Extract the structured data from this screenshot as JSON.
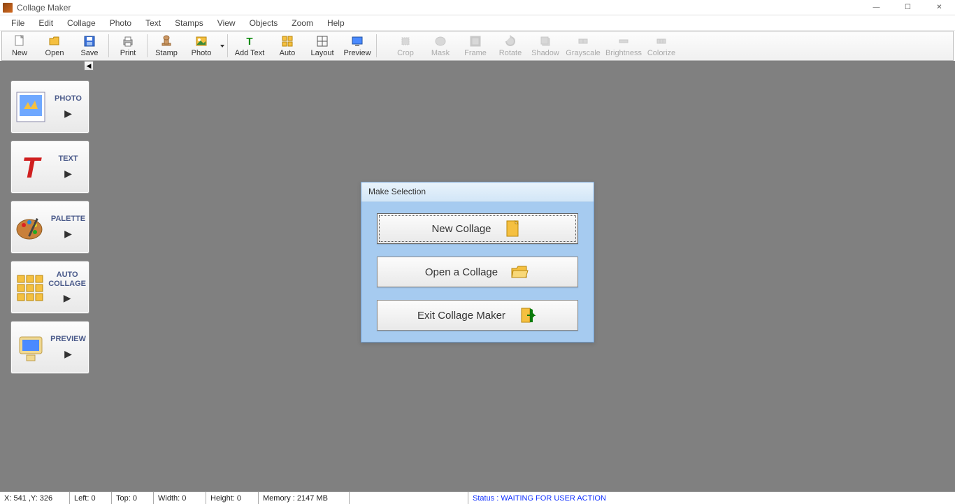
{
  "window": {
    "title": "Collage Maker",
    "controls": {
      "min": "—",
      "max": "☐",
      "close": "✕"
    }
  },
  "menu": [
    "File",
    "Edit",
    "Collage",
    "Photo",
    "Text",
    "Stamps",
    "View",
    "Objects",
    "Zoom",
    "Help"
  ],
  "toolbar": {
    "primary": [
      {
        "id": "new",
        "label": "New"
      },
      {
        "id": "open",
        "label": "Open"
      },
      {
        "id": "save",
        "label": "Save"
      },
      {
        "id": "print",
        "label": "Print"
      },
      {
        "id": "stamp",
        "label": "Stamp"
      },
      {
        "id": "photo",
        "label": "Photo",
        "dropdown": true
      },
      {
        "id": "addtext",
        "label": "Add Text"
      },
      {
        "id": "auto",
        "label": "Auto"
      },
      {
        "id": "layout",
        "label": "Layout"
      },
      {
        "id": "preview",
        "label": "Preview"
      }
    ],
    "secondary": [
      {
        "id": "crop",
        "label": "Crop"
      },
      {
        "id": "mask",
        "label": "Mask"
      },
      {
        "id": "frame",
        "label": "Frame"
      },
      {
        "id": "rotate",
        "label": "Rotate"
      },
      {
        "id": "shadow",
        "label": "Shadow"
      },
      {
        "id": "grayscale",
        "label": "Grayscale"
      },
      {
        "id": "brightness",
        "label": "Brightness"
      },
      {
        "id": "colorize",
        "label": "Colorize"
      }
    ]
  },
  "sidebar": [
    {
      "id": "photo",
      "label": "PHOTO"
    },
    {
      "id": "text",
      "label": "TEXT"
    },
    {
      "id": "palette",
      "label": "PALETTE"
    },
    {
      "id": "autocollage",
      "label": "AUTO COLLAGE"
    },
    {
      "id": "preview",
      "label": "PREVIEW"
    }
  ],
  "dialog": {
    "title": "Make Selection",
    "buttons": [
      {
        "id": "new-collage",
        "label": "New Collage"
      },
      {
        "id": "open-collage",
        "label": "Open a Collage"
      },
      {
        "id": "exit",
        "label": "Exit Collage Maker"
      }
    ]
  },
  "status": {
    "coords": "X: 541 ,Y: 326",
    "left": "Left: 0",
    "top": "Top: 0",
    "width": "Width: 0",
    "height": "Height: 0",
    "memory": "Memory : 2147 MB",
    "status_text": "Status : WAITING FOR USER ACTION"
  }
}
